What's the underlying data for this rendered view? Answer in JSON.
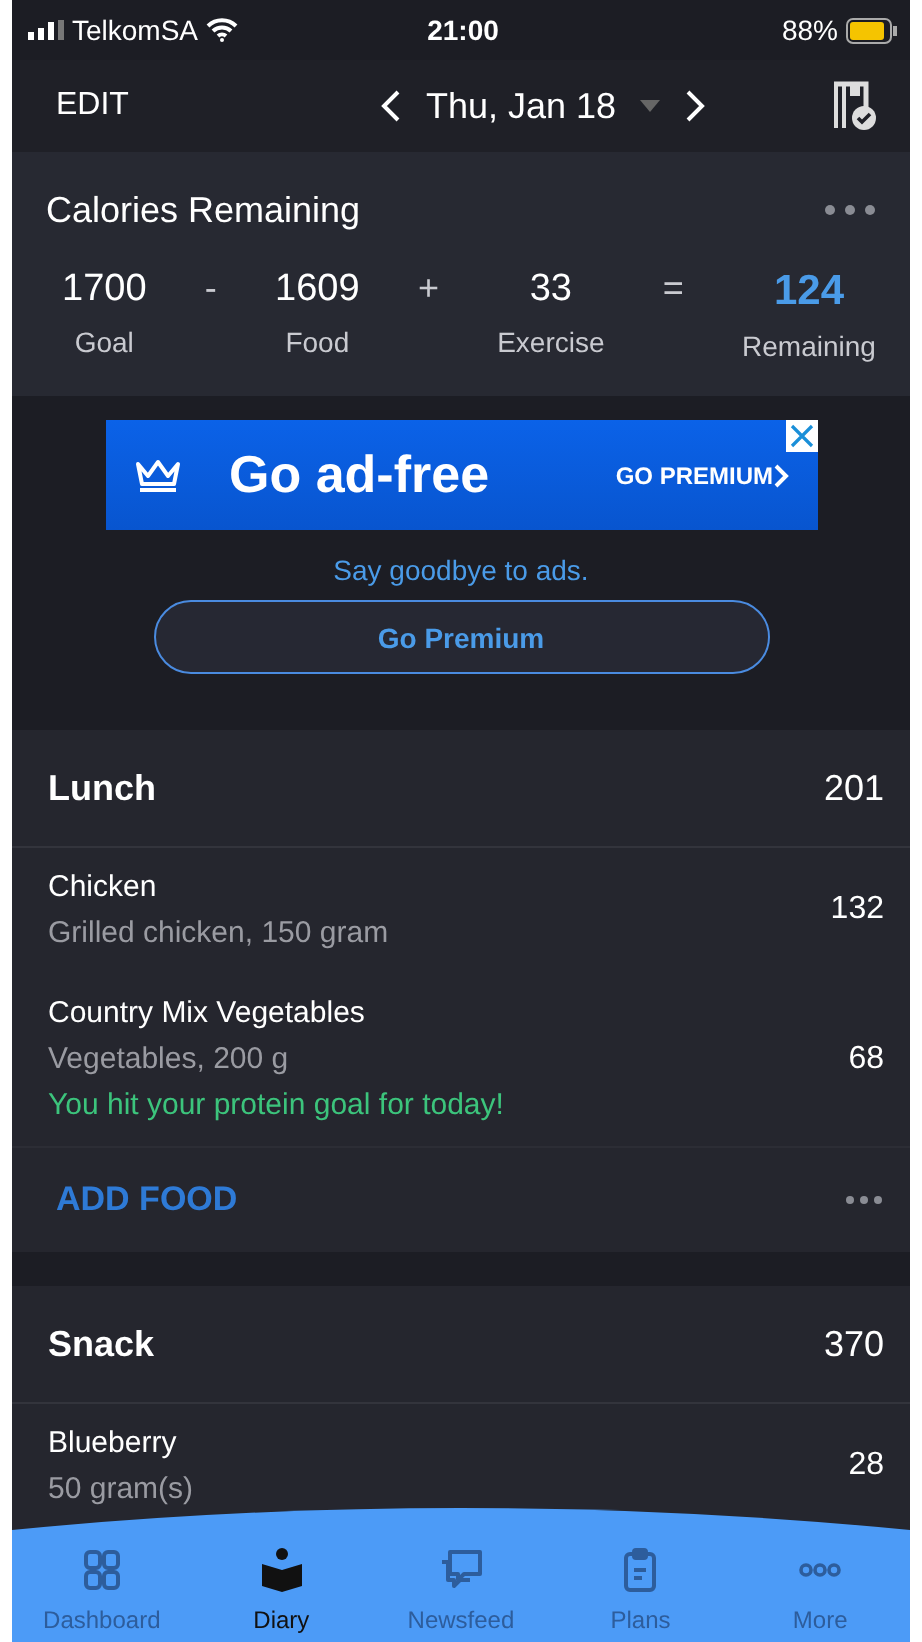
{
  "status_bar": {
    "carrier": "TelkomSA",
    "time": "21:00",
    "battery": "88%"
  },
  "nav": {
    "edit": "EDIT",
    "date": "Thu, Jan 18"
  },
  "calories": {
    "title": "Calories Remaining",
    "terms": [
      {
        "kind": "value",
        "value": "1700",
        "label": "Goal"
      },
      {
        "kind": "operator",
        "value": "-"
      },
      {
        "kind": "value",
        "value": "1609",
        "label": "Food"
      },
      {
        "kind": "operator",
        "value": "+"
      },
      {
        "kind": "value",
        "value": "33",
        "label": "Exercise"
      },
      {
        "kind": "operator",
        "value": "="
      },
      {
        "kind": "result",
        "value": "124",
        "label": "Remaining"
      }
    ]
  },
  "ad": {
    "headline": "Go ad-free",
    "cta": "GO PREMIUM",
    "tagline": "Say goodbye to ads.",
    "button": "Go Premium"
  },
  "meals": [
    {
      "name": "Lunch",
      "calories": "201",
      "add_label": "ADD FOOD",
      "foods": [
        {
          "name": "Chicken",
          "detail": "Grilled chicken, 150 gram",
          "calories": "132"
        },
        {
          "name": "Country Mix Vegetables",
          "detail": "Vegetables, 200 g",
          "calories": "68",
          "note": "You hit your protein goal for today!"
        }
      ]
    },
    {
      "name": "Snack",
      "calories": "370",
      "foods": [
        {
          "name": "Blueberry",
          "detail": "50 gram(s)",
          "calories": "28"
        }
      ]
    }
  ],
  "tabs": [
    {
      "label": "Dashboard",
      "selected": false
    },
    {
      "label": "Diary",
      "selected": true
    },
    {
      "label": "Newsfeed",
      "selected": false
    },
    {
      "label": "Plans",
      "selected": false
    },
    {
      "label": "More",
      "selected": false
    }
  ]
}
